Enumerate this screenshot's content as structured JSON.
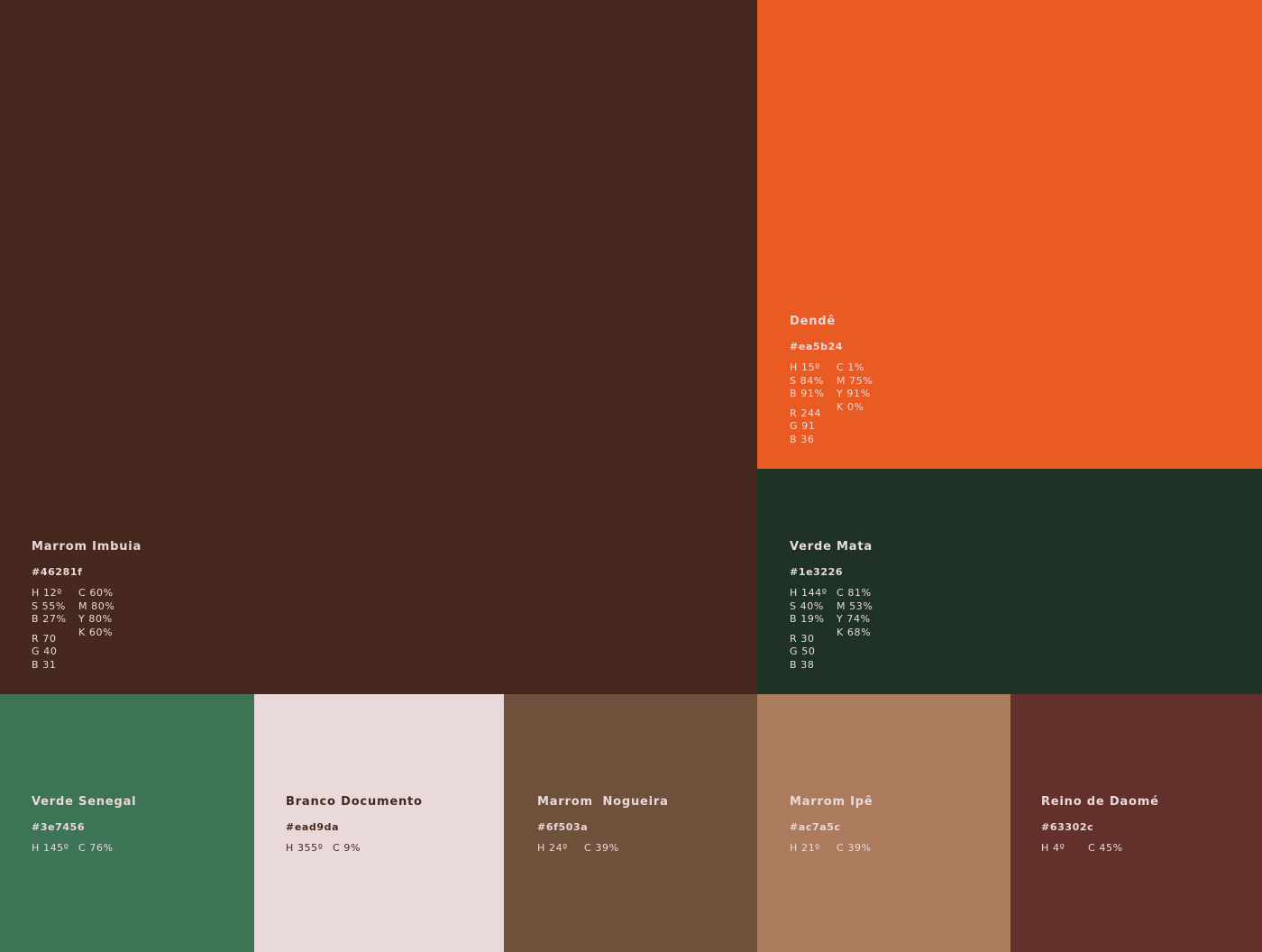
{
  "colors": {
    "imbuia": "#46281f",
    "dende": "#ea5b24",
    "mata": "#1e3226",
    "senegal": "#3e7456",
    "documento": "#ead9da",
    "nogueira": "#6f503a",
    "ipe": "#ac7a5c",
    "daome": "#63302c",
    "text_light": "#ead9da",
    "text_dark": "#46281f"
  },
  "imbuia": {
    "name": "Marrom Imbuia",
    "hex": "#46281f",
    "h": "H 12º",
    "s": "S 55%",
    "b": "B 27%",
    "r": "R 70",
    "g": "G 40",
    "bl": "B 31",
    "c": "C 60%",
    "m": "M 80%",
    "y": "Y 80%",
    "k": "K 60%"
  },
  "dende": {
    "name": "Dendê",
    "hex": "#ea5b24",
    "h": "H 15º",
    "s": "S 84%",
    "b": "B 91%",
    "r": "R 244",
    "g": "G 91",
    "bl": "B 36",
    "c": "C 1%",
    "m": "M 75%",
    "y": "Y 91%",
    "k": "K 0%"
  },
  "mata": {
    "name": "Verde Mata",
    "hex": "#1e3226",
    "h": "H 144º",
    "s": "S 40%",
    "b": "B 19%",
    "r": "R 30",
    "g": "G 50",
    "bl": "B 38",
    "c": "C 81%",
    "m": "M 53%",
    "y": "Y 74%",
    "k": "K 68%"
  },
  "senegal": {
    "name": "Verde Senegal",
    "hex": "#3e7456",
    "h": "H 145º",
    "c": "C 76%"
  },
  "documento": {
    "name": "Branco Documento",
    "hex": "#ead9da",
    "h": "H 355º",
    "c": "C 9%"
  },
  "nogueira": {
    "name": "Marrom  Nogueira",
    "hex": "#6f503a",
    "h": "H 24º",
    "c": "C 39%"
  },
  "ipe": {
    "name": "Marrom Ipê",
    "hex": "#ac7a5c",
    "h": "H 21º",
    "c": "C 39%"
  },
  "daome": {
    "name": "Reino de Daomé",
    "hex": "#63302c",
    "h": "H 4º",
    "c": "C 45%"
  }
}
